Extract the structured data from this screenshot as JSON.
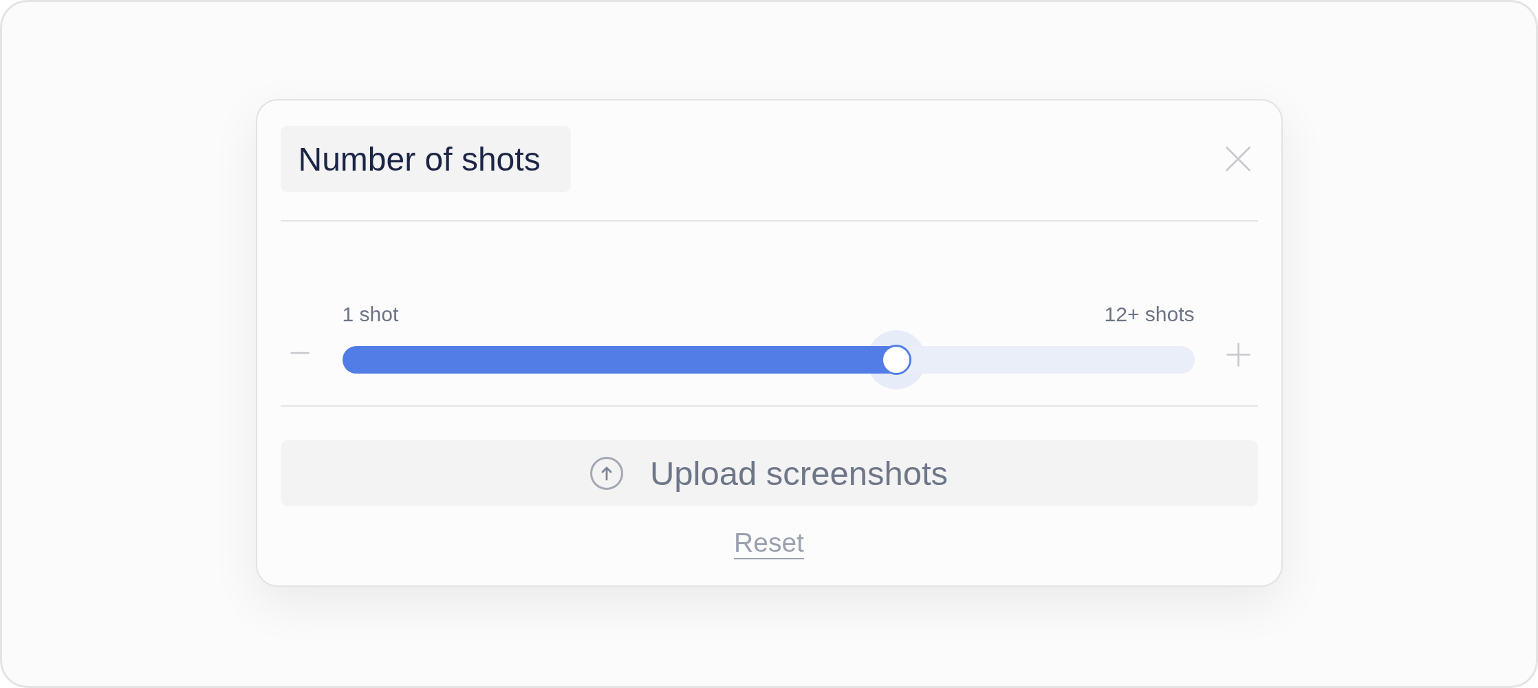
{
  "dialog": {
    "title": "Number of shots"
  },
  "slider": {
    "min_label": "1 shot",
    "max_label": "12+ shots",
    "level": 0.65
  },
  "upload_button": {
    "label": "Upload screenshots"
  },
  "reset_link": {
    "label": "Reset"
  }
}
